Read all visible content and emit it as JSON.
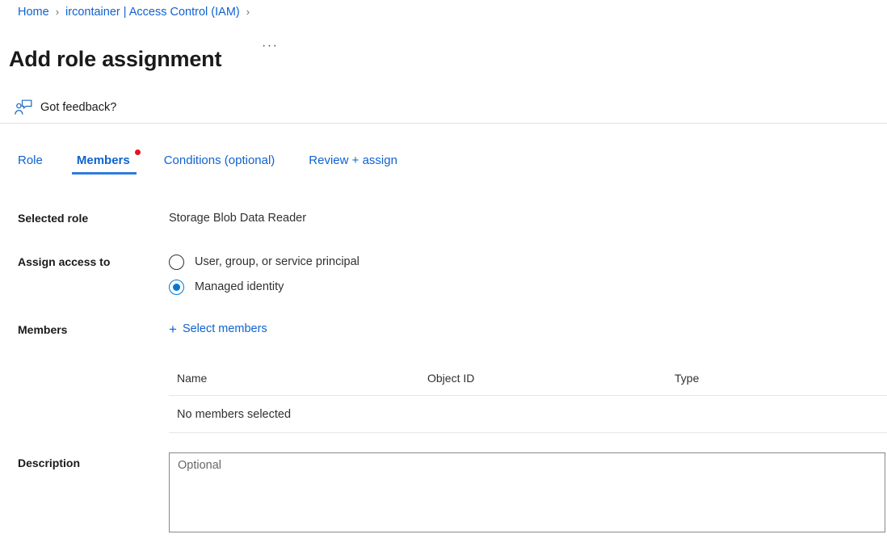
{
  "breadcrumb": {
    "items": [
      {
        "label": "Home",
        "link": true
      },
      {
        "label": "ircontainer | Access Control (IAM)",
        "link": true
      }
    ],
    "separator": "›"
  },
  "header": {
    "title": "Add role assignment",
    "more_label": "···"
  },
  "feedback": {
    "label": "Got feedback?",
    "icon": "feedback-person-icon"
  },
  "tabs": [
    {
      "label": "Role",
      "active": false,
      "badge": false
    },
    {
      "label": "Members",
      "active": true,
      "badge": true
    },
    {
      "label": "Conditions (optional)",
      "active": false,
      "badge": false
    },
    {
      "label": "Review + assign",
      "active": false,
      "badge": false
    }
  ],
  "form": {
    "selected_role": {
      "label": "Selected role",
      "value": "Storage Blob Data Reader"
    },
    "assign_access_to": {
      "label": "Assign access to",
      "options": [
        {
          "label": "User, group, or service principal",
          "selected": false
        },
        {
          "label": "Managed identity",
          "selected": true
        }
      ]
    },
    "members": {
      "label": "Members",
      "select_action": "Select members",
      "plus_icon": "+",
      "table": {
        "columns": [
          "Name",
          "Object ID",
          "Type"
        ],
        "rows": [],
        "empty_text": "No members selected"
      }
    },
    "description": {
      "label": "Description",
      "placeholder": "Optional",
      "value": ""
    }
  },
  "colors": {
    "link_blue": "#0f62d0",
    "accent_blue": "#0078d4",
    "tab_underline": "#2f7bdb",
    "badge_red": "#e81123",
    "border_gray": "#e1dfdd",
    "text_primary": "#1b1a19"
  }
}
